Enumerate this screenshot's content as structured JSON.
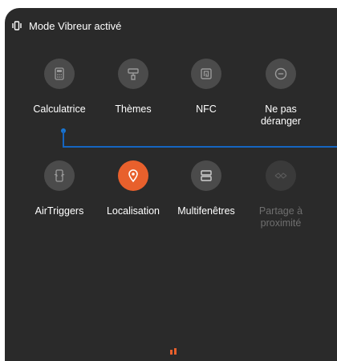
{
  "status": {
    "icon": "vibrate-icon",
    "text": "Mode Vibreur activé"
  },
  "tiles_row1": [
    {
      "name": "calculatrice",
      "icon": "calculator-icon",
      "label": "Calculatrice",
      "state": "off"
    },
    {
      "name": "themes",
      "icon": "paint-roller-icon",
      "label": "Thèmes",
      "state": "off"
    },
    {
      "name": "nfc",
      "icon": "nfc-icon",
      "label": "NFC",
      "state": "off"
    },
    {
      "name": "ne-pas-deranger",
      "icon": "do-not-disturb-icon",
      "label": "Ne pas\ndéranger",
      "state": "off"
    }
  ],
  "tiles_row2": [
    {
      "name": "airtriggers",
      "icon": "airtriggers-icon",
      "label": "AirTriggers",
      "state": "off"
    },
    {
      "name": "localisation",
      "icon": "location-pin-icon",
      "label": "Localisation",
      "state": "on"
    },
    {
      "name": "multifenetres",
      "icon": "split-screen-icon",
      "label": "Multifenêtres",
      "state": "off"
    },
    {
      "name": "partage-proximite",
      "icon": "nearby-share-icon",
      "label": "Partage à\nproximité",
      "state": "disabled"
    }
  ],
  "colors": {
    "panel": "#2a2a2a",
    "tile_off": "#4b4b4b",
    "tile_on": "#e8602c",
    "connector": "#1565c0"
  }
}
